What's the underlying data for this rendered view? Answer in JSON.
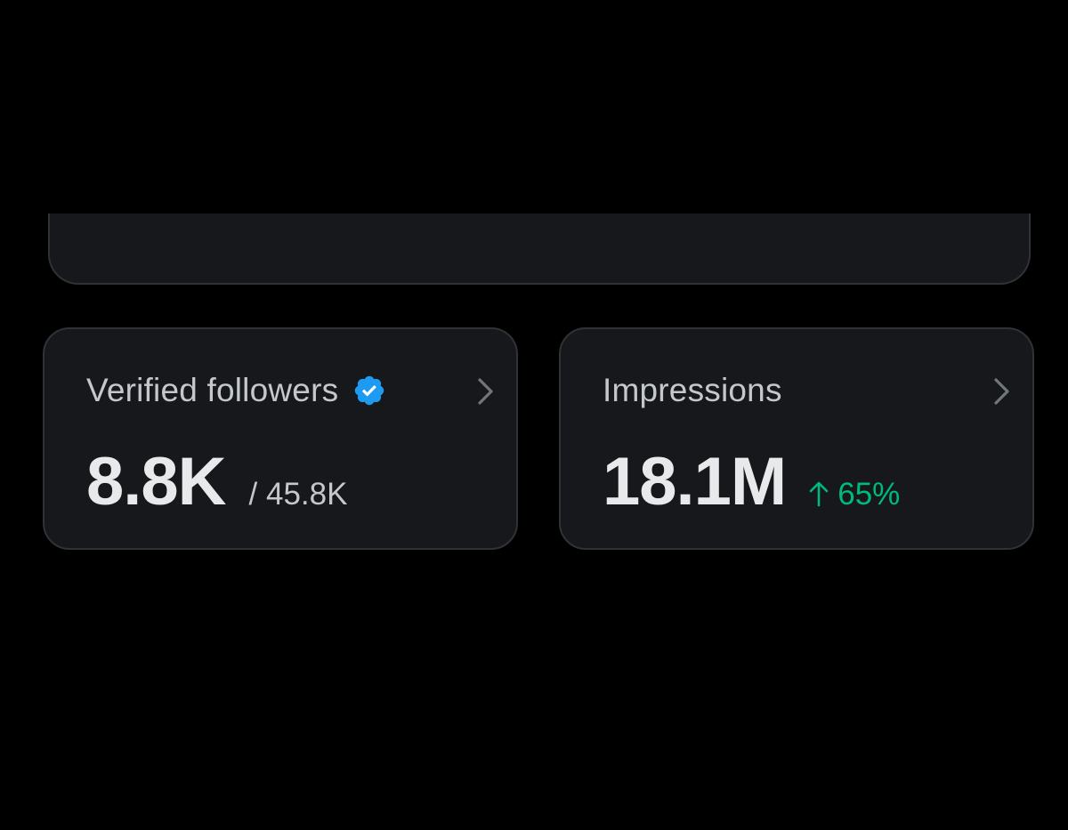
{
  "colors": {
    "background": "#000000",
    "card_background": "#16181c",
    "card_border": "#2f3336",
    "primary_text": "#e7e9ea",
    "secondary_text": "#c4c7cb",
    "verified_blue": "#1d9bf0",
    "positive_green": "#00ba7c"
  },
  "cards": [
    {
      "title": "Verified followers",
      "icon": "verified-badge-icon",
      "value": "8.8K",
      "total": "/ 45.8K",
      "chevron_icon": "chevron-right-icon"
    },
    {
      "title": "Impressions",
      "value": "18.1M",
      "change_icon": "arrow-up-icon",
      "change": "65%",
      "chevron_icon": "chevron-right-icon"
    }
  ]
}
